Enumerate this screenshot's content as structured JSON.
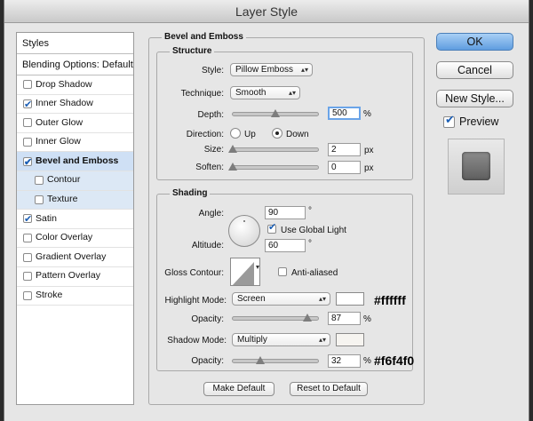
{
  "window": {
    "title": "Layer Style"
  },
  "styles_panel": {
    "header": "Styles",
    "blending": "Blending Options: Default",
    "items": [
      {
        "label": "Drop Shadow",
        "checked": false,
        "sub": false,
        "selected": false
      },
      {
        "label": "Inner Shadow",
        "checked": true,
        "sub": false,
        "selected": false
      },
      {
        "label": "Outer Glow",
        "checked": false,
        "sub": false,
        "selected": false
      },
      {
        "label": "Inner Glow",
        "checked": false,
        "sub": false,
        "selected": false
      },
      {
        "label": "Bevel and Emboss",
        "checked": true,
        "sub": false,
        "selected": true
      },
      {
        "label": "Contour",
        "checked": false,
        "sub": true,
        "selected": false
      },
      {
        "label": "Texture",
        "checked": false,
        "sub": true,
        "selected": false
      },
      {
        "label": "Satin",
        "checked": true,
        "sub": false,
        "selected": false
      },
      {
        "label": "Color Overlay",
        "checked": false,
        "sub": false,
        "selected": false
      },
      {
        "label": "Gradient Overlay",
        "checked": false,
        "sub": false,
        "selected": false
      },
      {
        "label": "Pattern Overlay",
        "checked": false,
        "sub": false,
        "selected": false
      },
      {
        "label": "Stroke",
        "checked": false,
        "sub": false,
        "selected": false
      }
    ]
  },
  "bevel": {
    "title": "Bevel and Emboss",
    "structure": {
      "title": "Structure",
      "style_label": "Style:",
      "style_value": "Pillow Emboss",
      "technique_label": "Technique:",
      "technique_value": "Smooth",
      "depth_label": "Depth:",
      "depth_value": "500",
      "depth_unit": "%",
      "depth_slider": 0.5,
      "direction_label": "Direction:",
      "dir_up": "Up",
      "dir_down": "Down",
      "size_label": "Size:",
      "size_value": "2",
      "size_unit": "px",
      "size_slider": 0.0,
      "soften_label": "Soften:",
      "soften_value": "0",
      "soften_unit": "px",
      "soften_slider": 0.0
    },
    "shading": {
      "title": "Shading",
      "angle_label": "Angle:",
      "angle_value": "90",
      "angle_unit": "°",
      "use_global_label": "Use Global Light",
      "altitude_label": "Altitude:",
      "altitude_value": "60",
      "altitude_unit": "°",
      "gloss_label": "Gloss Contour:",
      "anti_aliased_label": "Anti-aliased",
      "highlight_label": "Highlight Mode:",
      "highlight_value": "Screen",
      "highlight_color": "#ffffff",
      "opacity1_label": "Opacity:",
      "opacity1_value": "87",
      "opacity1_unit": "%",
      "opacity1_slider": 0.87,
      "shadow_label": "Shadow Mode:",
      "shadow_value": "Multiply",
      "shadow_color": "#f6f4f0",
      "opacity2_label": "Opacity:",
      "opacity2_value": "32",
      "opacity2_unit": "%",
      "opacity2_slider": 0.32
    },
    "make_default": "Make Default",
    "reset_default": "Reset to Default"
  },
  "annotations": {
    "highlight_hex": "#ffffff",
    "shadow_hex": "#f6f4f0"
  },
  "actions": {
    "ok": "OK",
    "cancel": "Cancel",
    "new_style": "New Style...",
    "preview": "Preview"
  }
}
